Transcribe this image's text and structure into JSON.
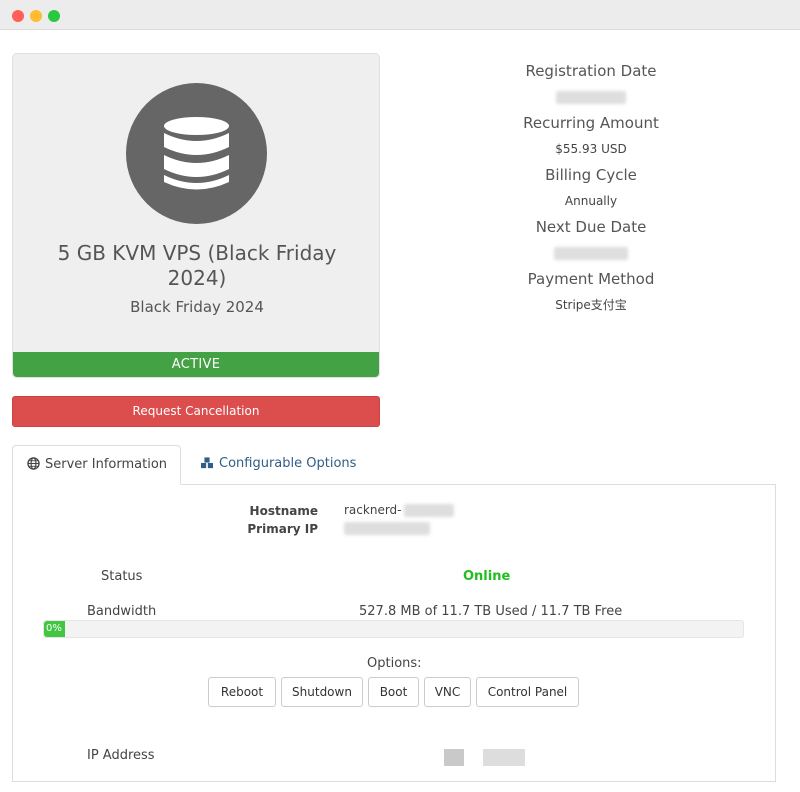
{
  "window": {
    "title_dots": [
      "close",
      "minimize",
      "maximize"
    ]
  },
  "product": {
    "icon": "database-icon",
    "name": "5 GB KVM VPS (Black Friday 2024)",
    "group": "Black Friday 2024",
    "status": "ACTIVE",
    "cancel_label": "Request Cancellation"
  },
  "billing": {
    "registration_date_label": "Registration Date",
    "recurring_amount_label": "Recurring Amount",
    "recurring_amount": "$55.93 USD",
    "billing_cycle_label": "Billing Cycle",
    "billing_cycle": "Annually",
    "next_due_date_label": "Next Due Date",
    "payment_method_label": "Payment Method",
    "payment_method": "Stripe支付宝"
  },
  "tabs": {
    "server_info": {
      "label": "Server Information",
      "icon": "globe-icon"
    },
    "config_options": {
      "label": "Configurable Options",
      "icon": "cubes-icon"
    }
  },
  "server": {
    "hostname_label": "Hostname",
    "hostname_value": "racknerd-",
    "primary_ip_label": "Primary IP",
    "status_label": "Status",
    "status_value": "Online",
    "bandwidth_label": "Bandwidth",
    "bandwidth_value": "527.8 MB of 11.7 TB Used / 11.7 TB Free",
    "bandwidth_percent_text": "0%",
    "bandwidth_percent": 0,
    "options_label": "Options:",
    "buttons": [
      "Reboot",
      "Shutdown",
      "Boot",
      "VNC",
      "Control Panel"
    ],
    "ip_address_label": "IP Address"
  },
  "colors": {
    "active": "#42a244",
    "cancel": "#dc4e4e",
    "online": "#1fbf1f",
    "link": "#2f5e87"
  }
}
